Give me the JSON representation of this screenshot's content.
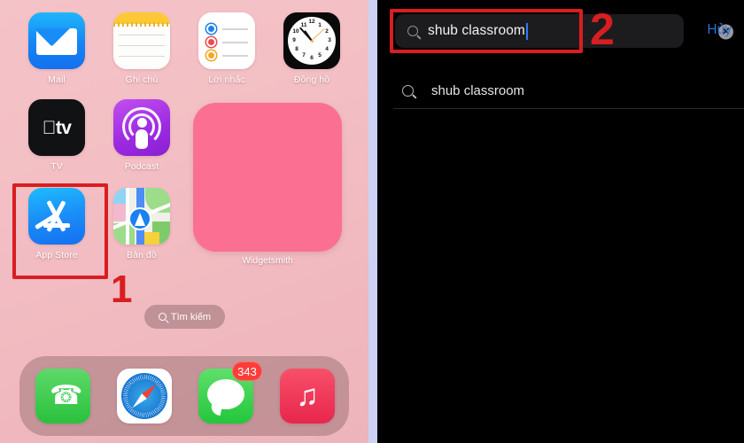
{
  "left_panel": {
    "name": "ios-home-screen",
    "wallpaper_color": "#f2c0c5",
    "apps_row1": [
      {
        "label": "Mail",
        "icon": "mail-icon"
      },
      {
        "label": "Ghi chú",
        "icon": "notes-icon"
      },
      {
        "label": "Lời nhắc",
        "icon": "reminders-icon"
      },
      {
        "label": "Đồng hồ",
        "icon": "clock-icon"
      }
    ],
    "apps_row2": [
      {
        "label": "TV",
        "icon": "apple-tv-icon"
      },
      {
        "label": "Podcast",
        "icon": "podcast-icon"
      }
    ],
    "apps_row3": [
      {
        "label": "App Store",
        "icon": "app-store-icon"
      },
      {
        "label": "Bản đồ",
        "icon": "maps-icon"
      }
    ],
    "widget": {
      "label": "Widgetsmith",
      "color": "#fb6f93"
    },
    "search_pill": {
      "label": "Tìm kiếm",
      "icon": "search-icon"
    },
    "dock": [
      {
        "label": "Phone",
        "icon": "phone-icon",
        "badge": ""
      },
      {
        "label": "Safari",
        "icon": "safari-icon",
        "badge": ""
      },
      {
        "label": "Messages",
        "icon": "messages-icon",
        "badge": "343"
      },
      {
        "label": "Music",
        "icon": "music-icon",
        "badge": ""
      }
    ],
    "clock_time": "10:53"
  },
  "annotations": [
    {
      "number": "1",
      "color": "#d81e20",
      "target": "app-store-icon"
    },
    {
      "number": "2",
      "color": "#d81e20",
      "target": "search-field"
    }
  ],
  "right_panel": {
    "name": "app-store-search",
    "background_color": "#000000",
    "search": {
      "value": "shub classroom",
      "placeholder": "Tìm kiếm",
      "icon": "search-icon",
      "clear_icon": "clear-circle-icon",
      "clear_glyph": "✕",
      "cancel_label": "Hủy",
      "cancel_color": "#2a72d6",
      "caret_color": "#2f7cf6"
    },
    "suggestions": [
      {
        "text": "shub classroom",
        "icon": "search-icon"
      }
    ]
  }
}
